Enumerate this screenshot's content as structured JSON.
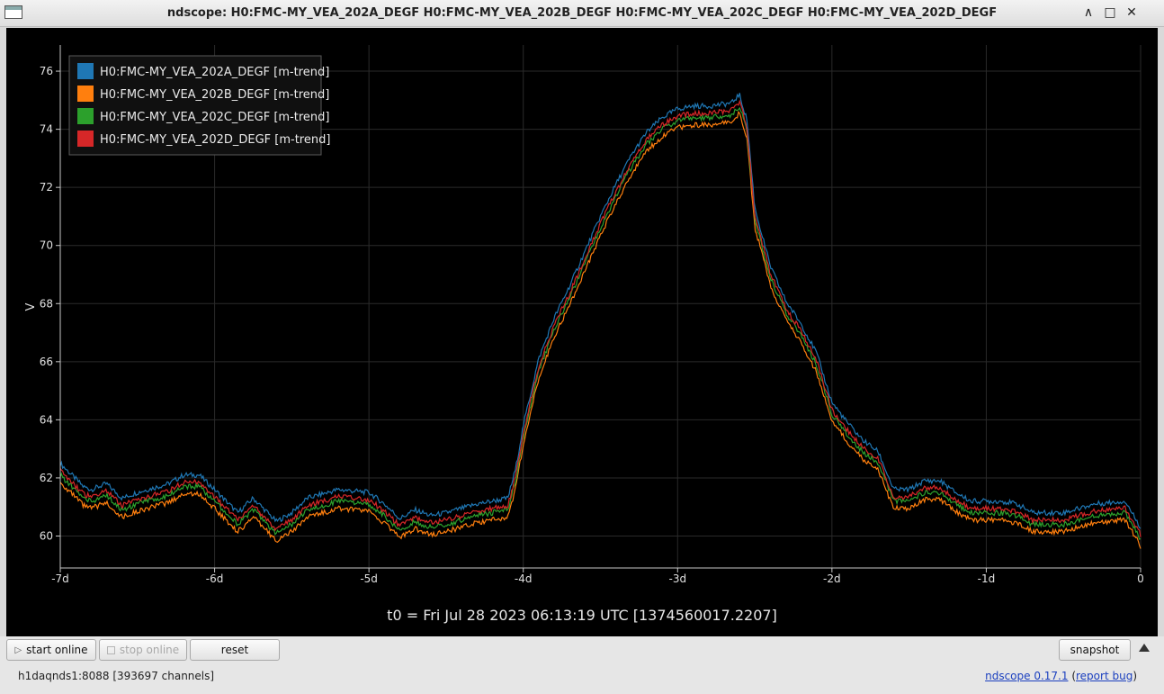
{
  "window": {
    "title": "ndscope: H0:FMC-MY_VEA_202A_DEGF H0:FMC-MY_VEA_202B_DEGF H0:FMC-MY_VEA_202C_DEGF H0:FMC-MY_VEA_202D_DEGF",
    "controls": {
      "minimize": "∧",
      "maximize": "□",
      "close": "✕"
    }
  },
  "plot": {
    "ylabel": "V",
    "t0_label": "t0 = Fri Jul 28 2023 06:13:19 UTC [1374560017.2207]"
  },
  "chart_data": {
    "type": "line",
    "ylabel": "V",
    "ylim": [
      58.9,
      76.9
    ],
    "xlim": [
      -7,
      0
    ],
    "grid": true,
    "legend_placement": "top-left",
    "x_ticks": [
      {
        "value": -7,
        "label": "-7d"
      },
      {
        "value": -6,
        "label": "-6d"
      },
      {
        "value": -5,
        "label": "-5d"
      },
      {
        "value": -4,
        "label": "-4d"
      },
      {
        "value": -3,
        "label": "-3d"
      },
      {
        "value": -2,
        "label": "-2d"
      },
      {
        "value": -1,
        "label": "-1d"
      },
      {
        "value": 0,
        "label": "0"
      }
    ],
    "y_ticks": [
      60,
      62,
      64,
      66,
      68,
      70,
      72,
      74,
      76
    ],
    "x": [
      -7.0,
      -6.85,
      -6.8,
      -6.7,
      -6.6,
      -6.5,
      -6.3,
      -6.2,
      -6.1,
      -6.0,
      -5.85,
      -5.75,
      -5.6,
      -5.5,
      -5.4,
      -5.2,
      -5.0,
      -4.9,
      -4.8,
      -4.7,
      -4.6,
      -4.5,
      -4.3,
      -4.1,
      -4.05,
      -4.0,
      -3.9,
      -3.8,
      -3.7,
      -3.6,
      -3.5,
      -3.4,
      -3.3,
      -3.2,
      -3.1,
      -3.0,
      -2.9,
      -2.8,
      -2.65,
      -2.6,
      -2.55,
      -2.5,
      -2.4,
      -2.3,
      -2.2,
      -2.1,
      -2.0,
      -1.9,
      -1.8,
      -1.7,
      -1.6,
      -1.5,
      -1.4,
      -1.3,
      -1.2,
      -1.1,
      -1.0,
      -0.9,
      -0.8,
      -0.7,
      -0.5,
      -0.3,
      -0.1,
      0.0
    ],
    "series": [
      {
        "name": "H0:FMC-MY_VEA_202A_DEGF [m-trend]",
        "color": "#1f77b4",
        "offset": 0.3,
        "values": [
          62.2,
          61.4,
          61.3,
          61.5,
          61.0,
          61.2,
          61.5,
          61.8,
          61.8,
          61.3,
          60.5,
          61.0,
          60.2,
          60.5,
          61.0,
          61.3,
          61.2,
          60.8,
          60.3,
          60.6,
          60.4,
          60.5,
          60.8,
          61.0,
          62.0,
          63.5,
          65.8,
          67.2,
          68.3,
          69.5,
          70.7,
          71.8,
          72.8,
          73.6,
          74.1,
          74.4,
          74.5,
          74.5,
          74.6,
          74.9,
          74.0,
          71.0,
          69.0,
          67.8,
          67.0,
          66.0,
          64.3,
          63.6,
          63.0,
          62.6,
          61.3,
          61.3,
          61.6,
          61.6,
          61.2,
          60.9,
          60.9,
          60.9,
          60.8,
          60.5,
          60.5,
          60.8,
          60.9,
          60.0
        ]
      },
      {
        "name": "H0:FMC-MY_VEA_202B_DEGF [m-trend]",
        "color": "#ff7f0e",
        "offset": -0.35,
        "values": [
          62.2,
          61.4,
          61.3,
          61.5,
          61.0,
          61.2,
          61.5,
          61.8,
          61.8,
          61.3,
          60.5,
          61.0,
          60.2,
          60.5,
          61.0,
          61.3,
          61.2,
          60.8,
          60.3,
          60.6,
          60.4,
          60.5,
          60.8,
          61.0,
          62.0,
          63.5,
          65.8,
          67.2,
          68.3,
          69.5,
          70.7,
          71.8,
          72.8,
          73.6,
          74.1,
          74.4,
          74.5,
          74.5,
          74.6,
          74.9,
          74.0,
          71.0,
          69.0,
          67.8,
          67.0,
          66.0,
          64.3,
          63.6,
          63.0,
          62.6,
          61.3,
          61.3,
          61.6,
          61.6,
          61.2,
          60.9,
          60.9,
          60.9,
          60.8,
          60.5,
          60.5,
          60.8,
          60.9,
          60.0
        ]
      },
      {
        "name": "H0:FMC-MY_VEA_202C_DEGF [m-trend]",
        "color": "#2ca02c",
        "offset": -0.1,
        "values": [
          62.2,
          61.4,
          61.3,
          61.5,
          61.0,
          61.2,
          61.5,
          61.8,
          61.8,
          61.3,
          60.5,
          61.0,
          60.2,
          60.5,
          61.0,
          61.3,
          61.2,
          60.8,
          60.3,
          60.6,
          60.4,
          60.5,
          60.8,
          61.0,
          62.0,
          63.5,
          65.8,
          67.2,
          68.3,
          69.5,
          70.7,
          71.8,
          72.8,
          73.6,
          74.1,
          74.4,
          74.5,
          74.5,
          74.6,
          74.9,
          74.0,
          71.0,
          69.0,
          67.8,
          67.0,
          66.0,
          64.3,
          63.6,
          63.0,
          62.6,
          61.3,
          61.3,
          61.6,
          61.6,
          61.2,
          60.9,
          60.9,
          60.9,
          60.8,
          60.5,
          60.5,
          60.8,
          60.9,
          60.0
        ]
      },
      {
        "name": "H0:FMC-MY_VEA_202D_DEGF [m-trend]",
        "color": "#d62728",
        "offset": 0.05,
        "values": [
          62.2,
          61.4,
          61.3,
          61.5,
          61.0,
          61.2,
          61.5,
          61.8,
          61.8,
          61.3,
          60.5,
          61.0,
          60.2,
          60.5,
          61.0,
          61.3,
          61.2,
          60.8,
          60.3,
          60.6,
          60.4,
          60.5,
          60.8,
          61.0,
          62.0,
          63.5,
          65.8,
          67.2,
          68.3,
          69.5,
          70.7,
          71.8,
          72.8,
          73.6,
          74.1,
          74.4,
          74.5,
          74.5,
          74.6,
          74.9,
          74.0,
          71.0,
          69.0,
          67.8,
          67.0,
          66.0,
          64.3,
          63.6,
          63.0,
          62.6,
          61.3,
          61.3,
          61.6,
          61.6,
          61.2,
          60.9,
          60.9,
          60.9,
          60.8,
          60.5,
          60.5,
          60.8,
          60.9,
          60.0
        ]
      }
    ]
  },
  "buttons": {
    "start_online": "start online",
    "stop_online": "stop online",
    "reset": "reset",
    "snapshot": "snapshot"
  },
  "status": {
    "server": "h1daqnds1:8088  [393697 channels]",
    "version_link": "ndscope 0.17.1",
    "report_bug_open": " (",
    "report_bug": "report bug",
    "report_bug_close": ")"
  }
}
